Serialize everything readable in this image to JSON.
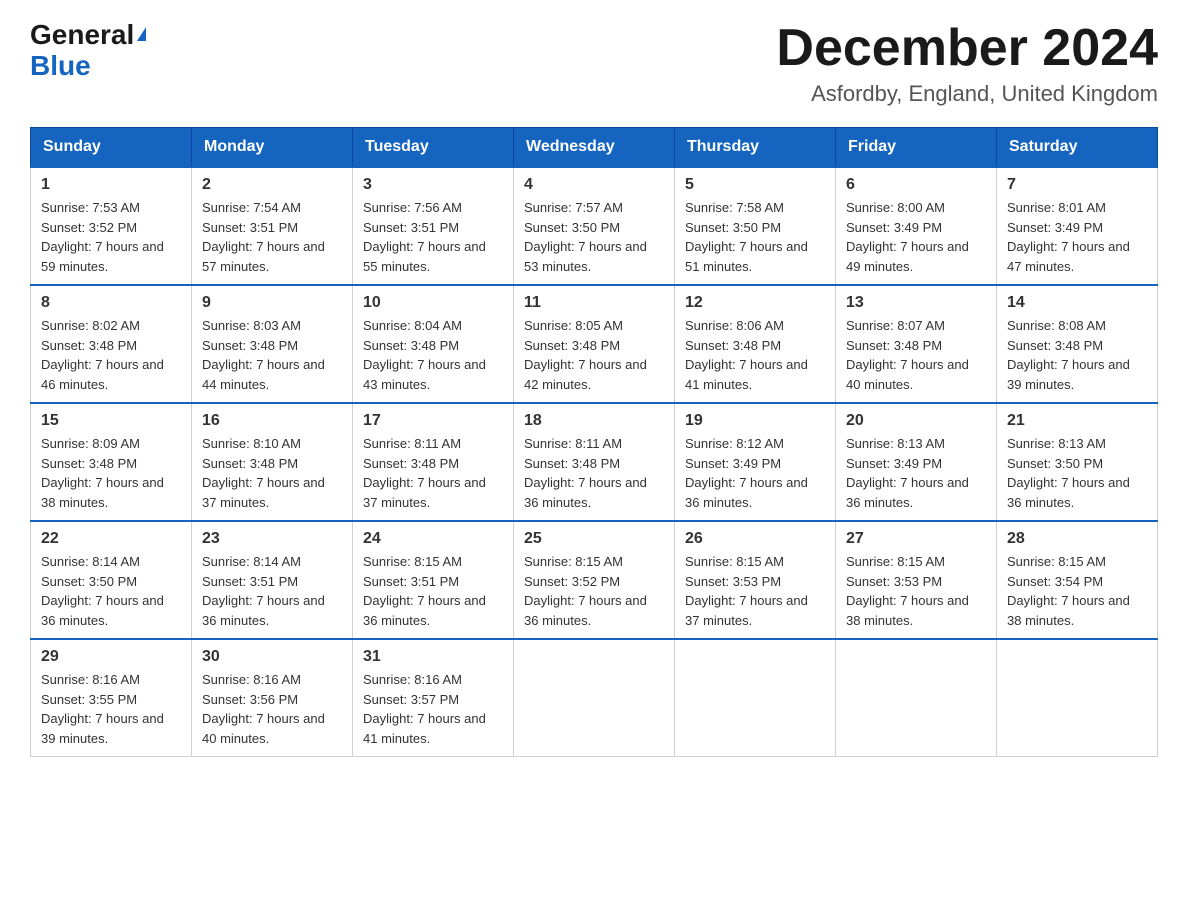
{
  "logo": {
    "general": "General",
    "triangle": "▶",
    "blue": "Blue"
  },
  "title": "December 2024",
  "subtitle": "Asfordby, England, United Kingdom",
  "days_of_week": [
    "Sunday",
    "Monday",
    "Tuesday",
    "Wednesday",
    "Thursday",
    "Friday",
    "Saturday"
  ],
  "weeks": [
    [
      {
        "day": "1",
        "sunrise": "7:53 AM",
        "sunset": "3:52 PM",
        "daylight": "7 hours and 59 minutes."
      },
      {
        "day": "2",
        "sunrise": "7:54 AM",
        "sunset": "3:51 PM",
        "daylight": "7 hours and 57 minutes."
      },
      {
        "day": "3",
        "sunrise": "7:56 AM",
        "sunset": "3:51 PM",
        "daylight": "7 hours and 55 minutes."
      },
      {
        "day": "4",
        "sunrise": "7:57 AM",
        "sunset": "3:50 PM",
        "daylight": "7 hours and 53 minutes."
      },
      {
        "day": "5",
        "sunrise": "7:58 AM",
        "sunset": "3:50 PM",
        "daylight": "7 hours and 51 minutes."
      },
      {
        "day": "6",
        "sunrise": "8:00 AM",
        "sunset": "3:49 PM",
        "daylight": "7 hours and 49 minutes."
      },
      {
        "day": "7",
        "sunrise": "8:01 AM",
        "sunset": "3:49 PM",
        "daylight": "7 hours and 47 minutes."
      }
    ],
    [
      {
        "day": "8",
        "sunrise": "8:02 AM",
        "sunset": "3:48 PM",
        "daylight": "7 hours and 46 minutes."
      },
      {
        "day": "9",
        "sunrise": "8:03 AM",
        "sunset": "3:48 PM",
        "daylight": "7 hours and 44 minutes."
      },
      {
        "day": "10",
        "sunrise": "8:04 AM",
        "sunset": "3:48 PM",
        "daylight": "7 hours and 43 minutes."
      },
      {
        "day": "11",
        "sunrise": "8:05 AM",
        "sunset": "3:48 PM",
        "daylight": "7 hours and 42 minutes."
      },
      {
        "day": "12",
        "sunrise": "8:06 AM",
        "sunset": "3:48 PM",
        "daylight": "7 hours and 41 minutes."
      },
      {
        "day": "13",
        "sunrise": "8:07 AM",
        "sunset": "3:48 PM",
        "daylight": "7 hours and 40 minutes."
      },
      {
        "day": "14",
        "sunrise": "8:08 AM",
        "sunset": "3:48 PM",
        "daylight": "7 hours and 39 minutes."
      }
    ],
    [
      {
        "day": "15",
        "sunrise": "8:09 AM",
        "sunset": "3:48 PM",
        "daylight": "7 hours and 38 minutes."
      },
      {
        "day": "16",
        "sunrise": "8:10 AM",
        "sunset": "3:48 PM",
        "daylight": "7 hours and 37 minutes."
      },
      {
        "day": "17",
        "sunrise": "8:11 AM",
        "sunset": "3:48 PM",
        "daylight": "7 hours and 37 minutes."
      },
      {
        "day": "18",
        "sunrise": "8:11 AM",
        "sunset": "3:48 PM",
        "daylight": "7 hours and 36 minutes."
      },
      {
        "day": "19",
        "sunrise": "8:12 AM",
        "sunset": "3:49 PM",
        "daylight": "7 hours and 36 minutes."
      },
      {
        "day": "20",
        "sunrise": "8:13 AM",
        "sunset": "3:49 PM",
        "daylight": "7 hours and 36 minutes."
      },
      {
        "day": "21",
        "sunrise": "8:13 AM",
        "sunset": "3:50 PM",
        "daylight": "7 hours and 36 minutes."
      }
    ],
    [
      {
        "day": "22",
        "sunrise": "8:14 AM",
        "sunset": "3:50 PM",
        "daylight": "7 hours and 36 minutes."
      },
      {
        "day": "23",
        "sunrise": "8:14 AM",
        "sunset": "3:51 PM",
        "daylight": "7 hours and 36 minutes."
      },
      {
        "day": "24",
        "sunrise": "8:15 AM",
        "sunset": "3:51 PM",
        "daylight": "7 hours and 36 minutes."
      },
      {
        "day": "25",
        "sunrise": "8:15 AM",
        "sunset": "3:52 PM",
        "daylight": "7 hours and 36 minutes."
      },
      {
        "day": "26",
        "sunrise": "8:15 AM",
        "sunset": "3:53 PM",
        "daylight": "7 hours and 37 minutes."
      },
      {
        "day": "27",
        "sunrise": "8:15 AM",
        "sunset": "3:53 PM",
        "daylight": "7 hours and 38 minutes."
      },
      {
        "day": "28",
        "sunrise": "8:15 AM",
        "sunset": "3:54 PM",
        "daylight": "7 hours and 38 minutes."
      }
    ],
    [
      {
        "day": "29",
        "sunrise": "8:16 AM",
        "sunset": "3:55 PM",
        "daylight": "7 hours and 39 minutes."
      },
      {
        "day": "30",
        "sunrise": "8:16 AM",
        "sunset": "3:56 PM",
        "daylight": "7 hours and 40 minutes."
      },
      {
        "day": "31",
        "sunrise": "8:16 AM",
        "sunset": "3:57 PM",
        "daylight": "7 hours and 41 minutes."
      },
      null,
      null,
      null,
      null
    ]
  ],
  "labels": {
    "sunrise": "Sunrise: ",
    "sunset": "Sunset: ",
    "daylight": "Daylight: "
  }
}
